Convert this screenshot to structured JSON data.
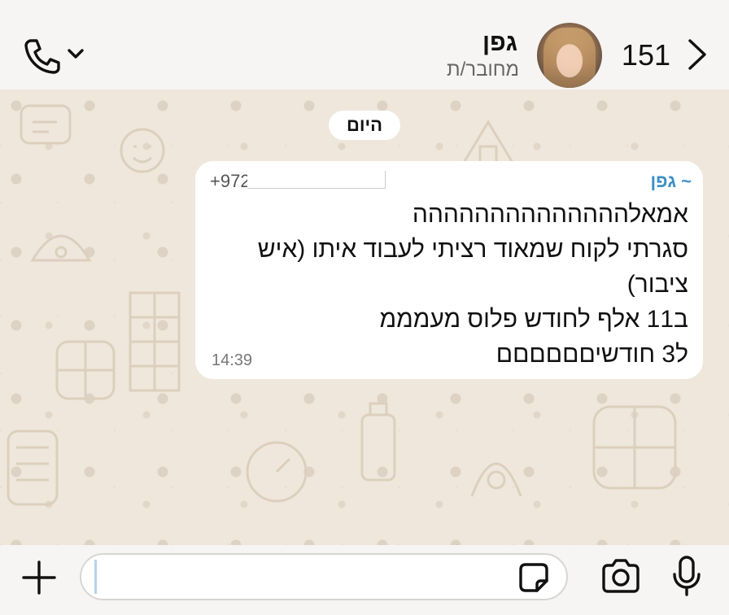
{
  "header": {
    "back_count": "151",
    "contact_name": "גפן",
    "contact_status": "מחובר/ת"
  },
  "chat": {
    "date_label": "היום",
    "message": {
      "sender": "~ גפן",
      "phone_visible": "+972",
      "lines": [
        "אמאלהההההההההההההה",
        "סגרתי לקוח שמאוד רציתי לעבוד איתו (איש",
        "ציבור)",
        "ב11 אלף לחודש פלוס מעמממ",
        "ל3 חודשיםםםםםם"
      ],
      "time": "14:39"
    }
  },
  "input": {
    "placeholder": ""
  },
  "icons": {
    "back": "chevron-right-icon",
    "call": "phone-icon",
    "call_menu": "chevron-down-icon",
    "attach": "plus-icon",
    "sticker": "sticker-icon",
    "camera": "camera-icon",
    "mic": "microphone-icon"
  },
  "colors": {
    "sender": "#3b8fc4",
    "wallpaper": "#efe7dc",
    "bubble": "#ffffff"
  }
}
